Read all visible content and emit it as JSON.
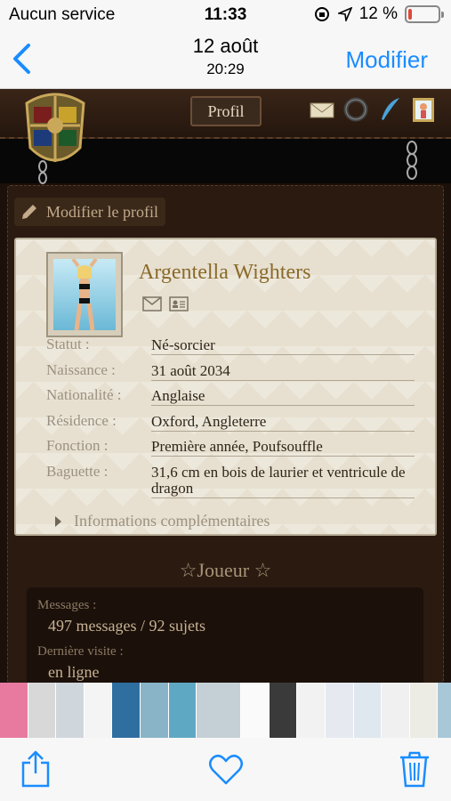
{
  "status_bar": {
    "carrier": "Aucun service",
    "time": "11:33",
    "battery": "12 %",
    "battery_level": 0.12,
    "battery_color": "#e0483a"
  },
  "nav": {
    "back_icon": "chevron-left-icon",
    "date": "12 août",
    "time": "20:29",
    "edit_label": "Modifier",
    "accent": "#1a8cff"
  },
  "forum": {
    "tab_label": "Profil",
    "top_icons": [
      "envelope-icon",
      "ring-icon",
      "quill-icon",
      "portrait-icon"
    ],
    "edit_profile_label": "Modifier le profil",
    "profile": {
      "name": "Argentella Wighters",
      "rows": [
        {
          "label": "Statut :",
          "value": "Né-sorcier"
        },
        {
          "label": "Naissance :",
          "value": "31 août 2034"
        },
        {
          "label": "Nationalité :",
          "value": "Anglaise"
        },
        {
          "label": "Résidence :",
          "value": "Oxford, Angleterre"
        },
        {
          "label": "Fonction :",
          "value": "Première année, Poufsouffle"
        },
        {
          "label": "Baguette :",
          "value": "31,6 cm en bois de laurier et ventricule de dragon"
        }
      ],
      "more_label": "Informations complémentaires"
    },
    "player": {
      "heading": "☆Joueur ☆",
      "messages_label": "Messages :",
      "messages_value": "497 messages / 92 sujets",
      "last_visit_label": "Dernière visite :",
      "last_visit_value": "en ligne"
    }
  },
  "toolbar": {
    "share": "share-icon",
    "favorite": "heart-icon",
    "delete": "trash-icon"
  }
}
